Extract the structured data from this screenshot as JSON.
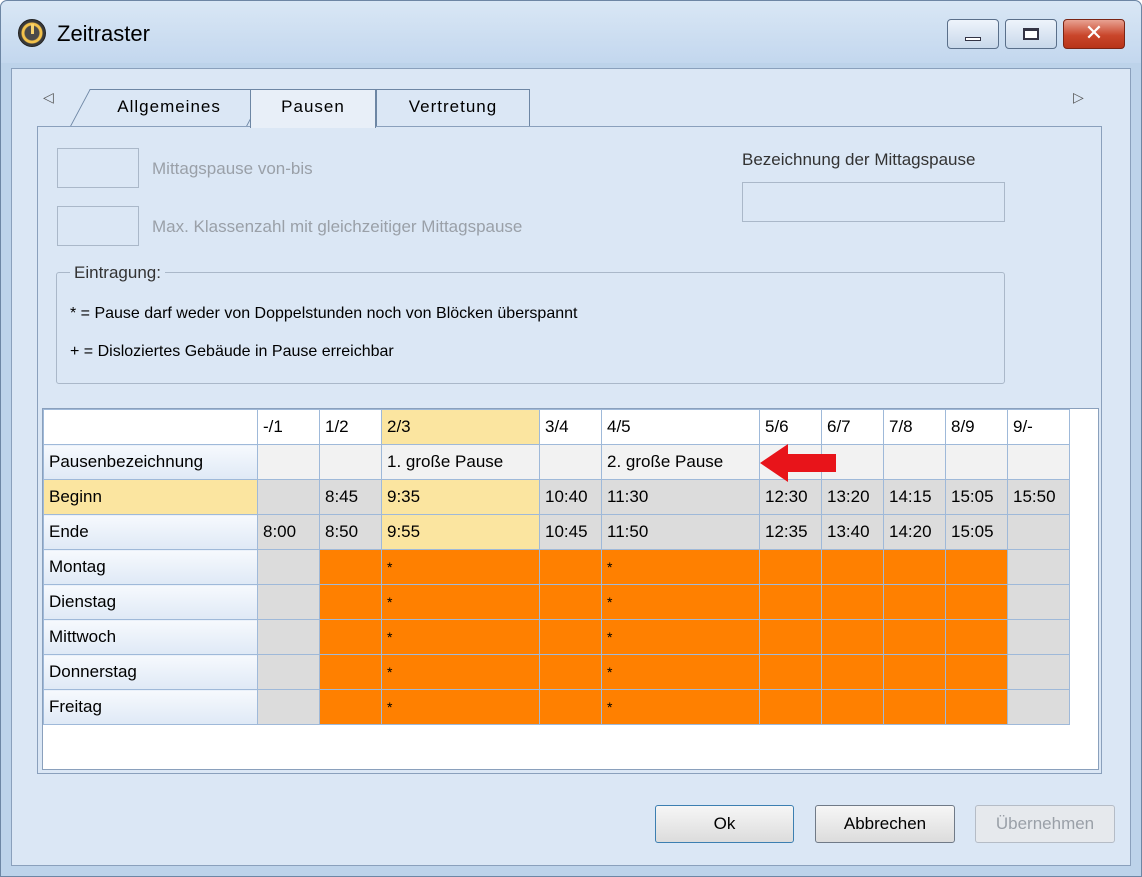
{
  "window": {
    "title": "Zeitraster",
    "icon": "clock-icon",
    "controls": {
      "minimize": "minimize-icon",
      "maximize": "maximize-icon",
      "close": "✕"
    }
  },
  "tabs": {
    "scroll_left": "◁",
    "scroll_right": "▷",
    "items": [
      {
        "label": "Allgemeines",
        "active": false
      },
      {
        "label": "Pausen",
        "active": true
      },
      {
        "label": "Vertretung",
        "active": false
      }
    ]
  },
  "form": {
    "mittagspause_label": "Mittagspause von-bis",
    "mittagspause_value": "",
    "max_klassen_label": "Max. Klassenzahl mit gleichzeitiger Mittagspause",
    "max_klassen_value": "",
    "bezeichnung_label": "Bezeichnung der Mittagspause",
    "bezeichnung_value": ""
  },
  "legend": {
    "title": "Eintragung:",
    "line1": "* = Pause darf weder von Doppelstunden noch von Blöcken überspannt",
    "line2": "+ = Disloziertes Gebäude in Pause erreichbar"
  },
  "grid": {
    "columns": [
      "-/1",
      "1/2",
      "2/3",
      "3/4",
      "4/5",
      "5/6",
      "6/7",
      "7/8",
      "8/9",
      "9/-"
    ],
    "selected_column": 2,
    "rows": {
      "pausenbezeichnung": {
        "label": "Pausenbezeichnung",
        "values": [
          "",
          "",
          "1. große Pause",
          "",
          "2. große Pause",
          "",
          "",
          "",
          "",
          ""
        ]
      },
      "beginn": {
        "label": "Beginn",
        "values": [
          "",
          "8:45",
          "9:35",
          "10:40",
          "11:30",
          "12:30",
          "13:20",
          "14:15",
          "15:05",
          "15:50"
        ]
      },
      "ende": {
        "label": "Ende",
        "values": [
          "8:00",
          "8:50",
          "9:55",
          "10:45",
          "11:50",
          "12:35",
          "13:40",
          "14:20",
          "15:05",
          ""
        ]
      }
    },
    "days": [
      {
        "label": "Montag",
        "marks": [
          "",
          "",
          "*",
          "",
          "*",
          "",
          "",
          "",
          "",
          ""
        ]
      },
      {
        "label": "Dienstag",
        "marks": [
          "",
          "",
          "*",
          "",
          "*",
          "",
          "",
          "",
          "",
          ""
        ]
      },
      {
        "label": "Mittwoch",
        "marks": [
          "",
          "",
          "*",
          "",
          "*",
          "",
          "",
          "",
          "",
          ""
        ]
      },
      {
        "label": "Donnerstag",
        "marks": [
          "",
          "",
          "*",
          "",
          "*",
          "",
          "",
          "",
          "",
          ""
        ]
      },
      {
        "label": "Freitag",
        "marks": [
          "",
          "",
          "*",
          "",
          "*",
          "",
          "",
          "",
          "",
          ""
        ]
      }
    ],
    "colors": {
      "break_cell": "#ff8000",
      "selected": "#fbe5a0",
      "disabled_cell": "#dcdcdc",
      "arrow": "#e8141a"
    }
  },
  "buttons": {
    "ok": "Ok",
    "cancel": "Abbrechen",
    "apply": "Übernehmen"
  }
}
